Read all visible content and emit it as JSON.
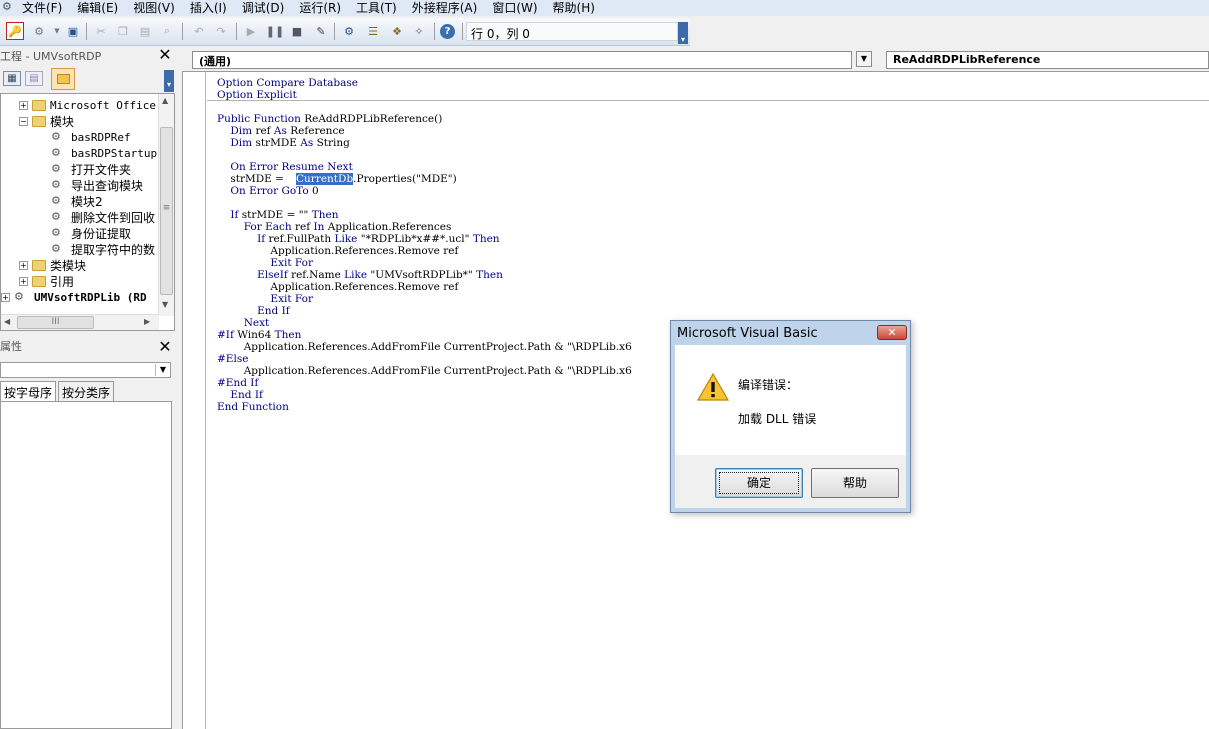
{
  "menubar": {
    "items": [
      "文件(F)",
      "编辑(E)",
      "视图(V)",
      "插入(I)",
      "调试(D)",
      "运行(R)",
      "工具(T)",
      "外接程序(A)",
      "窗口(W)",
      "帮助(H)"
    ]
  },
  "toolbar": {
    "cursor_position": "行 0，列 0",
    "buttons": [
      "access-icon",
      "insert-module-icon",
      "save-icon",
      "cut-icon",
      "copy-icon",
      "paste-icon",
      "find-icon",
      "undo-icon",
      "redo-icon",
      "run-icon",
      "break-icon",
      "reset-icon",
      "design-mode-icon",
      "project-explorer-icon",
      "properties-icon",
      "object-browser-icon",
      "toolbox-icon",
      "help-icon"
    ]
  },
  "project_panel": {
    "title": "工程 - UMVsoftRDP",
    "tree": [
      {
        "label": "Microsoft Office",
        "type": "folder",
        "expander": "+"
      },
      {
        "label": "模块",
        "type": "folder-open",
        "expander": "−"
      },
      {
        "label": "basRDPRef",
        "type": "module"
      },
      {
        "label": "basRDPStartup",
        "type": "module"
      },
      {
        "label": "打开文件夹",
        "type": "module"
      },
      {
        "label": "导出查询模块",
        "type": "module"
      },
      {
        "label": "模块2",
        "type": "module"
      },
      {
        "label": "删除文件到回收",
        "type": "module"
      },
      {
        "label": "身份证提取",
        "type": "module"
      },
      {
        "label": "提取字符中的数",
        "type": "module"
      },
      {
        "label": "类模块",
        "type": "folder",
        "expander": "+"
      },
      {
        "label": "引用",
        "type": "folder",
        "expander": "+"
      },
      {
        "label": "UMVsoftRDPLib (RD",
        "type": "project",
        "expander": "+"
      }
    ]
  },
  "properties_panel": {
    "title": "属性",
    "tabs": [
      "按字母序",
      "按分类序"
    ]
  },
  "code_window": {
    "object_combo": "(通用)",
    "procedure_combo": "ReAddRDPLibReference",
    "lines": [
      "Option Compare Database",
      "Option Explicit",
      "Public Function ReAddRDPLibReference()",
      "    Dim ref As Reference",
      "    Dim strMDE As String",
      "",
      "    On Error Resume Next",
      "    strMDE = ",
      "    On Error GoTo 0",
      "",
      "    If strMDE = \"\" Then",
      "        For Each ref In Application.References",
      "            If ref.FullPath Like \"*RDPLib*x##*.ucl\" Then",
      "                Application.References.Remove ref",
      "                Exit For",
      "            ElseIf ref.Name Like \"UMVsoftRDPLib*\" Then",
      "                Application.References.Remove ref",
      "                Exit For",
      "            End If",
      "        Next",
      "#If Win64 Then",
      "        Application.References.AddFromFile CurrentProject.Path & \"\\RDPLib.x6",
      "#Else",
      "        Application.References.AddFromFile CurrentProject.Path & \"\\RDPLib.x6",
      "#End If",
      "    End If",
      "End Function"
    ],
    "highlight_word": "CurrentDb",
    "highlight_rest": ".Properties(\"MDE\")"
  },
  "dialog": {
    "title": "Microsoft Visual Basic",
    "heading": "编译错误：",
    "message": "加载 DLL 错误",
    "ok_label": "确定",
    "help_label": "帮助",
    "close_label": "✕",
    "icon": "warning-icon"
  }
}
